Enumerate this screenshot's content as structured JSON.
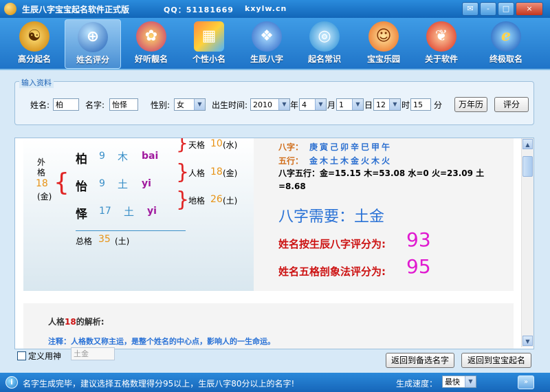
{
  "window": {
    "title": "生辰八字宝宝起名软件正式版",
    "qq": "QQ：51181669",
    "site": "kxylw.cn",
    "controls": [
      "-",
      "□",
      "×"
    ]
  },
  "toolbar": {
    "items": [
      {
        "label": "高分起名",
        "icon": "taiji-icon",
        "glyph": "☯",
        "active": false
      },
      {
        "label": "姓名评分",
        "icon": "globe-icon",
        "glyph": "⊕",
        "active": true
      },
      {
        "label": "好听靓名",
        "icon": "flower-icon",
        "glyph": "✿",
        "active": false
      },
      {
        "label": "个性小名",
        "icon": "window-logo-icon",
        "glyph": "▦",
        "active": false
      },
      {
        "label": "生辰八字",
        "icon": "blades-icon",
        "glyph": "❖",
        "active": false
      },
      {
        "label": "起名常识",
        "icon": "orbit-icon",
        "glyph": "◎",
        "active": false
      },
      {
        "label": "宝宝乐园",
        "icon": "headphones-icon",
        "glyph": "☺",
        "active": false
      },
      {
        "label": "关于软件",
        "icon": "leaves-icon",
        "glyph": "❦",
        "active": false
      },
      {
        "label": "终极取名",
        "icon": "ie-globe-icon",
        "glyph": "ℯ",
        "active": false
      }
    ]
  },
  "input_form": {
    "legend": "输入资料",
    "surname_label": "姓名:",
    "surname_value": "柏",
    "name_label": "名字:",
    "name_value": "怡怿",
    "gender_label": "性别:",
    "gender_value": "女",
    "birth_label": "出生时间:",
    "year_value": "2010",
    "year_unit": "年",
    "month_value": "4",
    "month_unit": "月",
    "day_value": "1",
    "day_unit": "日",
    "hour_value": "12",
    "hour_unit": "时",
    "minute_value": "15",
    "minute_unit": "分",
    "calendar_button": "万年历",
    "score_button": "评分"
  },
  "wuge": {
    "chars": [
      {
        "char": "柏",
        "strokes": "9",
        "element": "木",
        "pinyin": "bai"
      },
      {
        "char": "怡",
        "strokes": "9",
        "element": "土",
        "pinyin": "yi"
      },
      {
        "char": "怿",
        "strokes": "17",
        "element": "土",
        "pinyin": "yi"
      }
    ],
    "outer": {
      "label": "外格",
      "value": "18",
      "element": "(金)"
    },
    "tian": {
      "label": "天格",
      "value": "10",
      "element": "(水)"
    },
    "ren": {
      "label": "人格",
      "value": "18",
      "element": "(金)"
    },
    "di": {
      "label": "地格",
      "value": "26",
      "element": "(土)"
    },
    "total": {
      "label": "总格",
      "value": "35",
      "element": "(土)"
    }
  },
  "bazi": {
    "label": "八字：",
    "value": "庚寅己卯辛巳甲午",
    "wuxing_label": "五行：",
    "wuxing_value": "金木土木金火木火",
    "detail_line1": "八字五行：金=15.15 木=53.08 水=0 火=23.09 土",
    "detail_line2": "=8.68",
    "need": "八字需要：土金",
    "score1_text": "姓名按生辰八字评分为:",
    "score1_value": "93",
    "score2_text": "姓名五格剖象法评分为:",
    "score2_value": "95"
  },
  "analysis": {
    "title_prefix": "人格",
    "title_num": "18",
    "title_suffix": "的解析:",
    "note": "注释：人格数又称主运，是整个姓名的中心点，影响人的一生命运。"
  },
  "bottom": {
    "define_label": "定义用神",
    "define_value": "土金",
    "back_candidates": "返回到备选名字",
    "back_naming": "返回到宝宝起名"
  },
  "status": {
    "message": "名字生成完毕，建议选择五格数理得分95以上，生辰八字80分以上的名字!",
    "speed_label": "生成速度：",
    "speed_value": "最快"
  }
}
